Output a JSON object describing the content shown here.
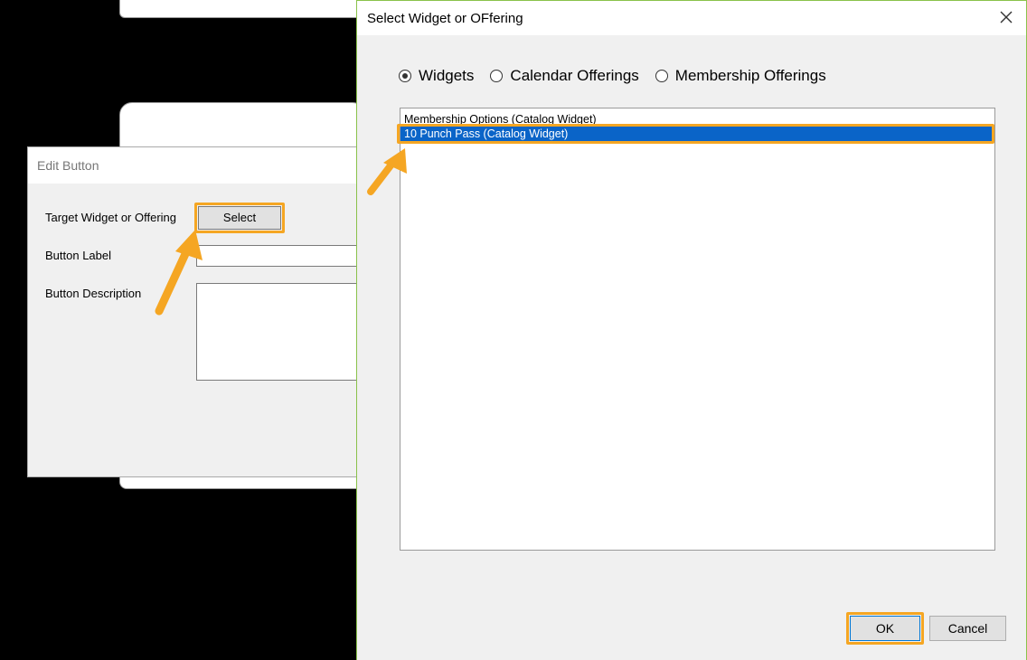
{
  "edit_dialog": {
    "title": "Edit Button",
    "target_label": "Target Widget or Offering",
    "select_button": "Select",
    "button_label": "Button Label",
    "button_description": "Button Description"
  },
  "select_dialog": {
    "title": "Select Widget or OFfering",
    "radios": [
      {
        "label": "Widgets",
        "checked": true
      },
      {
        "label": "Calendar Offerings",
        "checked": false
      },
      {
        "label": "Membership Offerings",
        "checked": false
      }
    ],
    "items": [
      {
        "label": "Membership Options (Catalog Widget)",
        "selected": false
      },
      {
        "label": "10 Punch Pass (Catalog Widget)",
        "selected": true
      }
    ],
    "ok_label": "OK",
    "cancel_label": "Cancel"
  },
  "colors": {
    "highlight": "#f5a623",
    "selection": "#0a64c8",
    "dialog_border": "#8ac24a"
  },
  "icons": [
    "close-icon",
    "arrow-pointer-icon"
  ]
}
